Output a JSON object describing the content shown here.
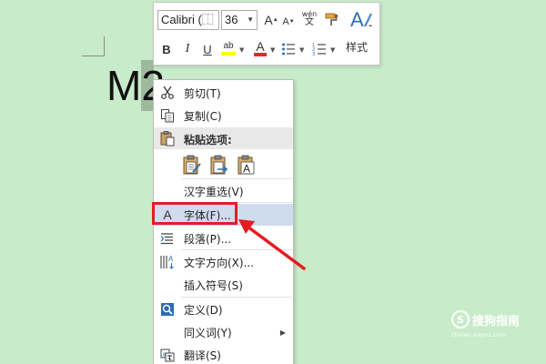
{
  "document": {
    "text_plain": "M",
    "text_selected": "2"
  },
  "mini_toolbar": {
    "font_name": "Calibri (⿰",
    "font_size": "36",
    "grow_label": "A",
    "shrink_label": "A",
    "pinyin_top": "wén",
    "pinyin_bottom": "文",
    "bold_label": "B",
    "italic_label": "I",
    "underline_label": "U",
    "highlight_label": "ab",
    "font_color_label": "A",
    "styles_label": "样式",
    "highlight_color": "#ffff00",
    "font_color": "#e8262c"
  },
  "context_menu": {
    "cut": "剪切(T)",
    "copy": "复制(C)",
    "paste_header": "粘贴选项:",
    "reconvert": "汉字重选(V)",
    "font": "字体(F)...",
    "paragraph": "段落(P)...",
    "text_direction": "文字方向(X)...",
    "insert_symbol": "插入符号(S)",
    "define": "定义(D)",
    "synonyms": "同义词(Y)",
    "translate": "翻译(S)"
  },
  "annotation": {
    "color": "#e51c23"
  },
  "watermark": {
    "logo": "S",
    "name": "搜狗指南",
    "url": "zhinan.sogou.com"
  }
}
